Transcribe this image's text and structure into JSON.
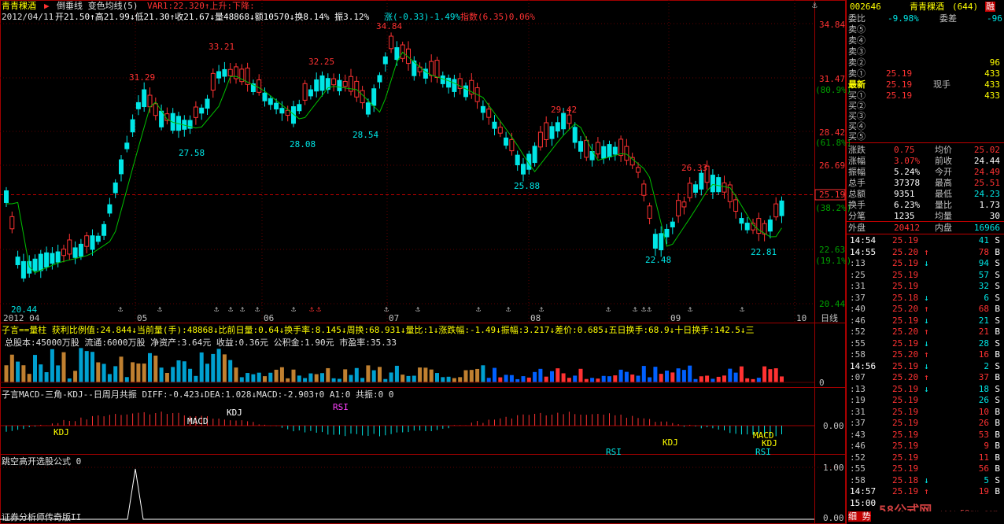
{
  "stock": {
    "name": "青青稞酒",
    "code": "002646",
    "count": "(644)",
    "flag": "融"
  },
  "main": {
    "title_name": "青青稞酒",
    "title_arrow": "▶",
    "indicators": "倒垂线  变色均线(5)",
    "var": "VAR1:22.320↑上升:下降:",
    "date": "2012/04/11",
    "ohlc": "开21.50↑高21.99↓低21.30↑收21.67↓量48868↓额10570↓换8.14% 振3.12%",
    "change": "涨(-0.33)-1.49%",
    "index": "指数(6.35)0.06%",
    "price_labels": [
      "34.84",
      "31.29",
      "33.21",
      "32.25",
      "29.42",
      "26.33",
      "27.58",
      "28.08",
      "28.54",
      "25.88",
      "22.48",
      "22.81",
      "20.44"
    ],
    "axis_right": [
      "34.84",
      "31.47",
      "(80.9%)",
      "28.42",
      "(61.8%)",
      "26.69",
      "25.19",
      "(38.2%)",
      "22.63",
      "(19.1%)",
      "20.44"
    ],
    "current_price": "25.19",
    "month_labels": [
      "2012 04",
      "05",
      "06",
      "07",
      "08",
      "09",
      "10"
    ],
    "axis_tag": "日线"
  },
  "volume": {
    "line1": "子言==量柱  获利比例值:24.844↓当前量(手):48868↓比前日量:0.64↓换手率:8.145↓周换:68.931↓量比:1↓涨跌幅:-1.49↓振幅:3.217↓差价:0.685↓五日换手:68.9↓十日换手:142.5↓三",
    "line2": "总股本:45000万股 流通:6000万股 净资产:3.64元 收益:0.36元 公积金:1.90元 市盈率:35.33",
    "axis_zero": "0"
  },
  "macd": {
    "line": "子言MACD-三角-KDJ--日周月共振  DIFF:-0.423↓DEA:1.028↓MACD:-2.903↑0 A1:0 共振:0 0",
    "labels": [
      "KDJ",
      "MACD",
      "KDJ",
      "RSI",
      "RSI",
      "KDJ",
      "MACD",
      "KDJ",
      "RSI"
    ],
    "axis": "0.00"
  },
  "jump": {
    "line": "跳空高开选股公式 0",
    "axis": [
      "1.00",
      "0.00"
    ]
  },
  "footer": "证券分析师传奇版II",
  "watermark": "58公式网",
  "watermark_url": "www.58gu.com",
  "orderbook": {
    "header_pct": "-9.98%",
    "header_diff": "-96",
    "header_extra": "委差",
    "asks": [
      {
        "label": "卖⑤",
        "price": "",
        "vol": ""
      },
      {
        "label": "卖④",
        "price": "",
        "vol": ""
      },
      {
        "label": "卖③",
        "price": "",
        "vol": ""
      },
      {
        "label": "卖②",
        "price": "",
        "vol": "96"
      },
      {
        "label": "卖①",
        "price": "25.19",
        "vol": "433"
      }
    ],
    "last": {
      "label": "最新",
      "price": "25.19",
      "extra": "现手",
      "vol": "433"
    },
    "bids": [
      {
        "label": "买①",
        "price": "25.19",
        "vol": "433"
      },
      {
        "label": "买②",
        "price": "",
        "vol": ""
      },
      {
        "label": "买③",
        "price": "",
        "vol": ""
      },
      {
        "label": "买④",
        "price": "",
        "vol": ""
      },
      {
        "label": "买⑤",
        "price": "",
        "vol": ""
      }
    ]
  },
  "stats": [
    {
      "l1": "涨跌",
      "v1": "0.75",
      "l2": "均价",
      "v2": "25.02"
    },
    {
      "l1": "涨幅",
      "v1": "3.07%",
      "l2": "前收",
      "v2": "24.44"
    },
    {
      "l1": "振幅",
      "v1": "5.24%",
      "l2": "今开",
      "v2": "24.49"
    },
    {
      "l1": "总手",
      "v1": "37378",
      "l2": "最高",
      "v2": "25.51"
    },
    {
      "l1": "总额",
      "v1": "9351",
      "l2": "最低",
      "v2": "24.23"
    },
    {
      "l1": "换手",
      "v1": "6.23%",
      "l2": "量比",
      "v2": "1.73"
    },
    {
      "l1": "分笔",
      "v1": "1235",
      "l2": "均量",
      "v2": "30"
    }
  ],
  "outer": {
    "l1": "外盘",
    "v1": "20412",
    "l2": "内盘",
    "v2": "16966"
  },
  "ticks": [
    {
      "time": "14:54",
      "price": "25.19",
      "arrow": "",
      "vol": "41",
      "side": "S"
    },
    {
      "time": "14:55",
      "price": "25.20",
      "arrow": "↑",
      "vol": "78",
      "side": "B"
    },
    {
      "time": ":13",
      "price": "25.19",
      "arrow": "↓",
      "vol": "94",
      "side": "S"
    },
    {
      "time": ":25",
      "price": "25.19",
      "arrow": "",
      "vol": "57",
      "side": "S"
    },
    {
      "time": ":31",
      "price": "25.19",
      "arrow": "",
      "vol": "32",
      "side": "S"
    },
    {
      "time": ":37",
      "price": "25.18",
      "arrow": "↓",
      "vol": "6",
      "side": "S"
    },
    {
      "time": ":40",
      "price": "25.20",
      "arrow": "↑",
      "vol": "68",
      "side": "B"
    },
    {
      "time": ":46",
      "price": "25.19",
      "arrow": "↓",
      "vol": "21",
      "side": "S"
    },
    {
      "time": ":52",
      "price": "25.20",
      "arrow": "↑",
      "vol": "21",
      "side": "B"
    },
    {
      "time": ":55",
      "price": "25.19",
      "arrow": "↓",
      "vol": "28",
      "side": "S"
    },
    {
      "time": ":58",
      "price": "25.20",
      "arrow": "↑",
      "vol": "16",
      "side": "B"
    },
    {
      "time": "14:56",
      "price": "25.19",
      "arrow": "↓",
      "vol": "2",
      "side": "S"
    },
    {
      "time": ":07",
      "price": "25.20",
      "arrow": "↑",
      "vol": "37",
      "side": "B"
    },
    {
      "time": ":13",
      "price": "25.19",
      "arrow": "↓",
      "vol": "18",
      "side": "S"
    },
    {
      "time": ":19",
      "price": "25.19",
      "arrow": "",
      "vol": "26",
      "side": "S"
    },
    {
      "time": ":31",
      "price": "25.19",
      "arrow": "",
      "vol": "10",
      "side": "B"
    },
    {
      "time": ":37",
      "price": "25.19",
      "arrow": "",
      "vol": "26",
      "side": "B"
    },
    {
      "time": ":43",
      "price": "25.19",
      "arrow": "",
      "vol": "53",
      "side": "B"
    },
    {
      "time": ":46",
      "price": "25.19",
      "arrow": "",
      "vol": "9",
      "side": "B"
    },
    {
      "time": ":52",
      "price": "25.19",
      "arrow": "",
      "vol": "11",
      "side": "B"
    },
    {
      "time": ":55",
      "price": "25.19",
      "arrow": "",
      "vol": "56",
      "side": "B"
    },
    {
      "time": ":58",
      "price": "25.18",
      "arrow": "↓",
      "vol": "5",
      "side": "S"
    },
    {
      "time": "14:57",
      "price": "25.19",
      "arrow": "↑",
      "vol": "19",
      "side": "B"
    },
    {
      "time": "15:00",
      "price": "",
      "arrow": "",
      "vol": "",
      "side": ""
    }
  ],
  "bottom_tab": "细 势",
  "colors": {
    "up": "#ff3232",
    "down": "#00e6e6",
    "bg": "#000000",
    "grid": "#800000",
    "ma": "#00c000",
    "yellow": "#ffff00",
    "text": "#c0c0c0"
  }
}
